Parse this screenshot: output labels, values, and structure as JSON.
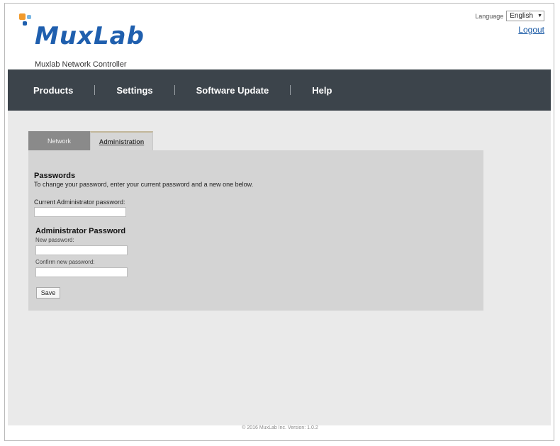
{
  "brand": {
    "logo_text": "MuxLab",
    "subtitle": "Muxlab Network Controller",
    "colors": {
      "blue": "#1f5fae",
      "orange": "#f19a2c",
      "light_blue": "#79b6e3"
    }
  },
  "header": {
    "language_label": "Language",
    "language_value": "English",
    "logout_label": "Logout"
  },
  "nav": {
    "items": [
      {
        "label": "Products"
      },
      {
        "label": "Settings"
      },
      {
        "label": "Software Update"
      },
      {
        "label": "Help"
      }
    ],
    "background": "#3c444b"
  },
  "tabs": {
    "network": "Network",
    "administration": "Administration"
  },
  "form": {
    "section_title": "Passwords",
    "description": "To change your password, enter your current password and a new one below.",
    "current_label": "Current Administrator password:",
    "current_value": "",
    "admin_title": "Administrator Password",
    "new_label": "New password:",
    "new_value": "",
    "confirm_label": "Confirm new password:",
    "confirm_value": "",
    "save_label": "Save"
  },
  "footer": {
    "text": "© 2016 MuxLab Inc. Version: 1.0.2"
  }
}
